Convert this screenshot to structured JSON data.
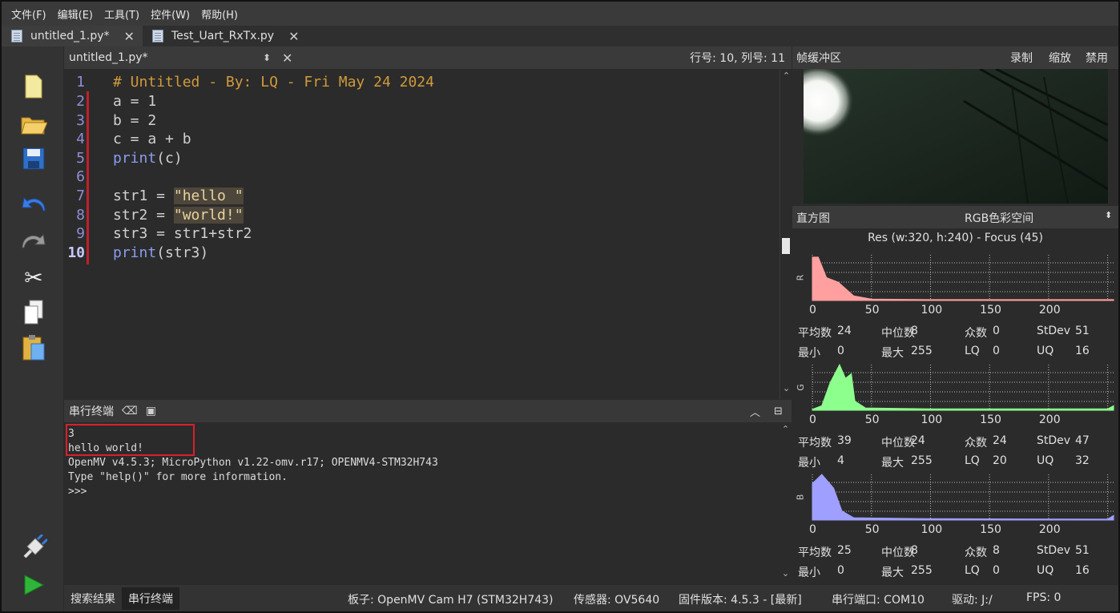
{
  "menu": [
    "文件(F)",
    "编辑(E)",
    "工具(T)",
    "控件(W)",
    "帮助(H)"
  ],
  "file_tabs": [
    {
      "label": "untitled_1.py*"
    },
    {
      "label": "Test_Uart_RxTx.py"
    }
  ],
  "editor": {
    "filename": "untitled_1.py*",
    "position": "行号: 10, 列号: 11",
    "line_numbers": [
      "1",
      "2",
      "3",
      "4",
      "5",
      "6",
      "7",
      "8",
      "9",
      "10"
    ],
    "lines": {
      "l1": "# Untitled - By: LQ - Fri May 24 2024",
      "l2": "a = 1",
      "l3": "b = 2",
      "l4": "c = a + b",
      "l5_kw": "print",
      "l5_rest": "(c)",
      "l7_a": "str1 = ",
      "l7_s": "\"hello \"",
      "l8_a": "str2 = ",
      "l8_s": "\"world!\"",
      "l9": "str3 = str1+str2",
      "l10_kw": "print",
      "l10_rest": "(str3)"
    }
  },
  "terminal": {
    "title": "串行终端",
    "output": [
      "3",
      "hello world!",
      "OpenMV v4.5.3; MicroPython v1.22-omv.r17; OPENMV4-STM32H743",
      "Type \"help()\" for more information.",
      ">>>"
    ]
  },
  "bottom_tabs": [
    "搜索结果",
    "串行终端"
  ],
  "status": {
    "board": "板子: OpenMV Cam H7 (STM32H743)",
    "sensor": "传感器: OV5640",
    "firmware": "固件版本: 4.5.3 - [最新]",
    "port": "串行端口: COM10",
    "drive": "驱动: J:/",
    "fps": "FPS: 0"
  },
  "framebuffer": {
    "title": "帧缓冲区",
    "record": "录制",
    "zoom": "缩放",
    "disable": "禁用"
  },
  "histogram": {
    "title": "直方图",
    "colorspace": "RGB色彩空间",
    "resolution": "Res (w:320, h:240) - Focus (45)",
    "axis_ticks": [
      "0",
      "50",
      "100",
      "150",
      "200"
    ],
    "channels": [
      {
        "label": "R",
        "color": "#ff9f9f",
        "mean_label": "平均数",
        "mean": "24",
        "median_label": "中位数",
        "median": "8",
        "mode_label": "众数",
        "mode": "0",
        "stdev_label": "StDev",
        "stdev": "51",
        "min_label": "最小",
        "min": "0",
        "max_label": "最大",
        "max": "255",
        "lq_label": "LQ",
        "lq": "0",
        "uq_label": "UQ",
        "uq": "16"
      },
      {
        "label": "G",
        "color": "#8dff8d",
        "mean_label": "平均数",
        "mean": "39",
        "median_label": "中位数",
        "median": "24",
        "mode_label": "众数",
        "mode": "24",
        "stdev_label": "StDev",
        "stdev": "47",
        "min_label": "最小",
        "min": "4",
        "max_label": "最大",
        "max": "255",
        "lq_label": "LQ",
        "lq": "20",
        "uq_label": "UQ",
        "uq": "32"
      },
      {
        "label": "B",
        "color": "#9f9fff",
        "mean_label": "平均数",
        "mean": "25",
        "median_label": "中位数",
        "median": "8",
        "mode_label": "众数",
        "mode": "8",
        "stdev_label": "StDev",
        "stdev": "51",
        "min_label": "最小",
        "min": "0",
        "max_label": "最大",
        "max": "255",
        "lq_label": "LQ",
        "lq": "0",
        "uq_label": "UQ",
        "uq": "16"
      }
    ]
  },
  "colors": {
    "accent_red": "#d9202a",
    "comment": "#d19a3b",
    "keyword": "#8a9cf0"
  }
}
